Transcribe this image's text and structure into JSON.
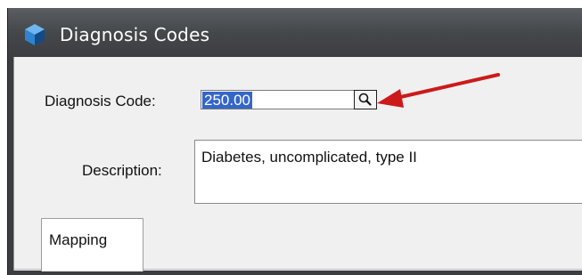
{
  "window": {
    "title": "Diagnosis Codes"
  },
  "form": {
    "code_label": "Diagnosis Code:",
    "code_value": "250.00",
    "description_label": "Description:",
    "description_value": "Diabetes, uncomplicated, type II"
  },
  "tabs": [
    {
      "label": "Mapping"
    }
  ],
  "annotation": {
    "arrow_color": "#cc1a1a"
  },
  "colors": {
    "selection": "#3466c8",
    "titlebar": "#45484b",
    "client_bg": "#f0f0f0"
  },
  "icons": {
    "app": "blue-gem-icon",
    "lookup": "magnifier-icon"
  }
}
